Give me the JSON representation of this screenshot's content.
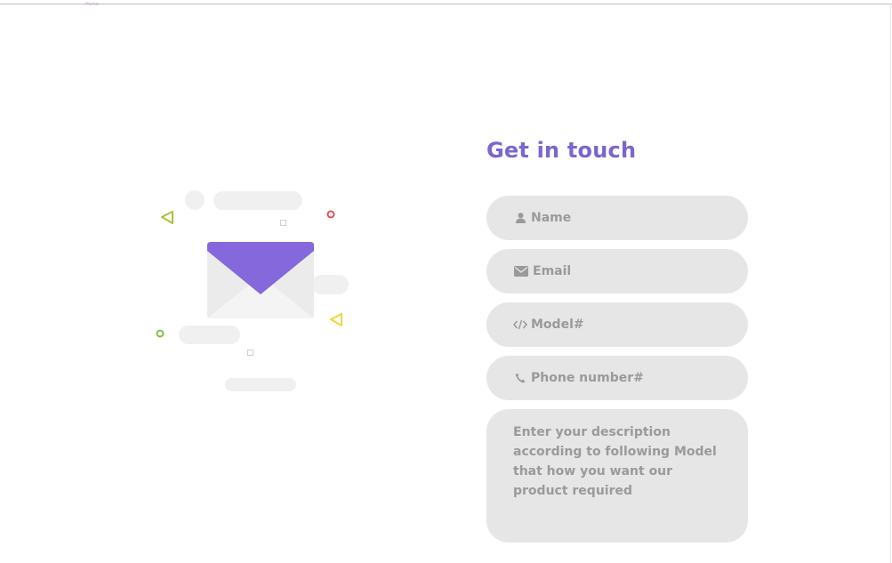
{
  "header": {
    "tiny_label": "Home"
  },
  "contact": {
    "title": "Get in touch",
    "name_placeholder": "Name",
    "email_placeholder": "Email",
    "model_placeholder": "Model#",
    "phone_placeholder": "Phone number#",
    "description_placeholder": "Enter your description according to following Model that how you want our product required"
  },
  "icons": {
    "name": "user-icon",
    "email": "envelope-icon",
    "model": "code-icon",
    "phone": "phone-icon",
    "illustration": "mail-envelope-icon"
  },
  "colors": {
    "accent": "#7d65cf",
    "field_bg": "#e6e6e6",
    "placeholder": "#9a9a9a",
    "envelope_flap": "#8468dc",
    "triangle_green": "#a6c43a",
    "triangle_yellow": "#f0d53a",
    "circle_red": "#e0505a",
    "circle_green": "#7cc44a"
  }
}
